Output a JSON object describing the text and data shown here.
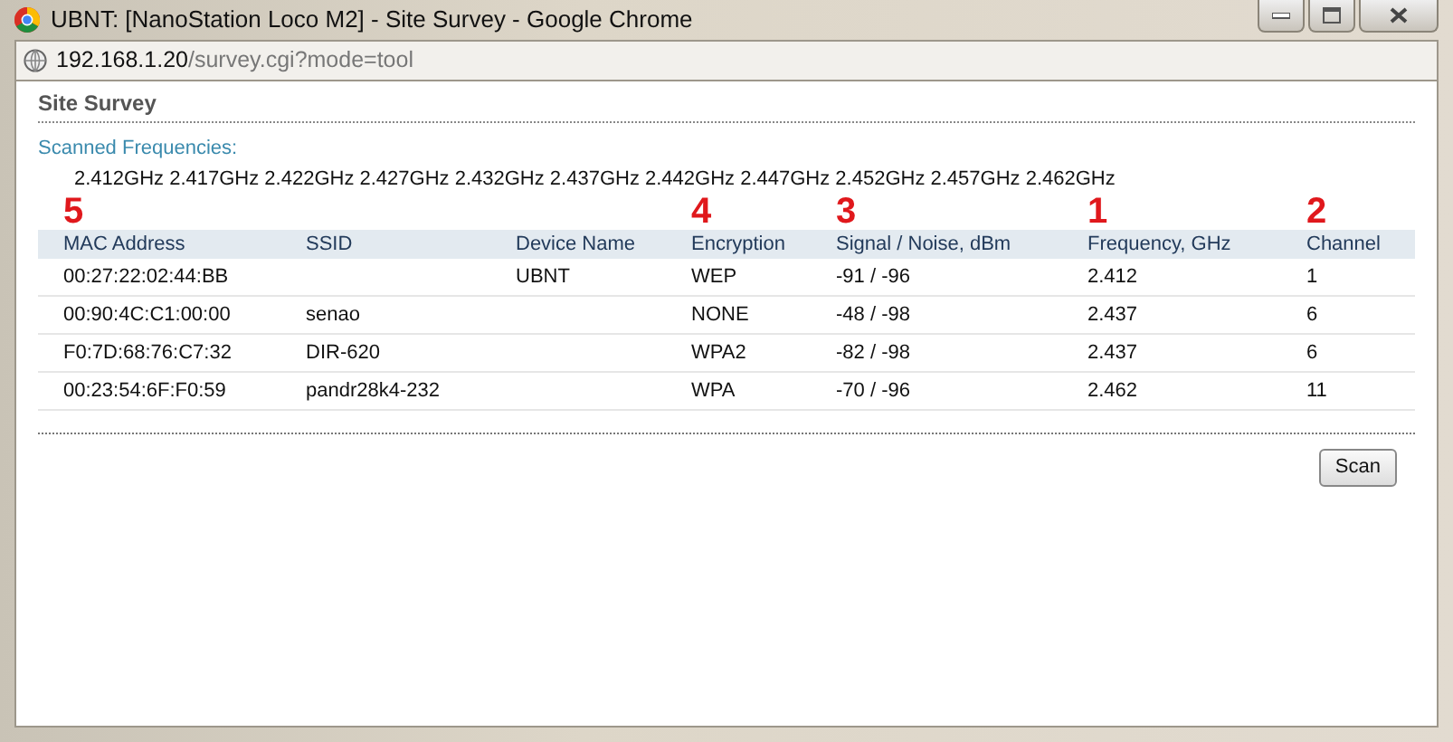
{
  "window": {
    "title": "UBNT: [NanoStation Loco M2] - Site Survey - Google Chrome"
  },
  "address_bar": {
    "host": "192.168.1.20",
    "path": "/survey.cgi?mode=tool"
  },
  "page": {
    "heading": "Site Survey",
    "scanned_label": "Scanned Frequencies:",
    "frequencies": "2.412GHz 2.417GHz 2.422GHz 2.427GHz 2.432GHz 2.437GHz 2.442GHz 2.447GHz 2.452GHz 2.457GHz 2.462GHz"
  },
  "table": {
    "columns": [
      {
        "label": "MAC Address",
        "annotation": "5"
      },
      {
        "label": "SSID"
      },
      {
        "label": "Device Name"
      },
      {
        "label": "Encryption",
        "annotation": "4"
      },
      {
        "label": "Signal / Noise, dBm",
        "annotation": "3"
      },
      {
        "label": "Frequency, GHz",
        "annotation": "1"
      },
      {
        "label": "Channel",
        "annotation": "2"
      }
    ],
    "rows": [
      [
        "00:27:22:02:44:BB",
        "",
        "UBNT",
        "WEP",
        "-91 / -96",
        "2.412",
        "1"
      ],
      [
        "00:90:4C:C1:00:00",
        "senao",
        "",
        "NONE",
        "-48 / -98",
        "2.437",
        "6"
      ],
      [
        "F0:7D:68:76:C7:32",
        "DIR-620",
        "",
        "WPA2",
        "-82 / -98",
        "2.437",
        "6"
      ],
      [
        "00:23:54:6F:F0:59",
        "pandr28k4-232",
        "",
        "WPA",
        "-70 / -96",
        "2.462",
        "11"
      ]
    ]
  },
  "buttons": [
    "Scan"
  ]
}
